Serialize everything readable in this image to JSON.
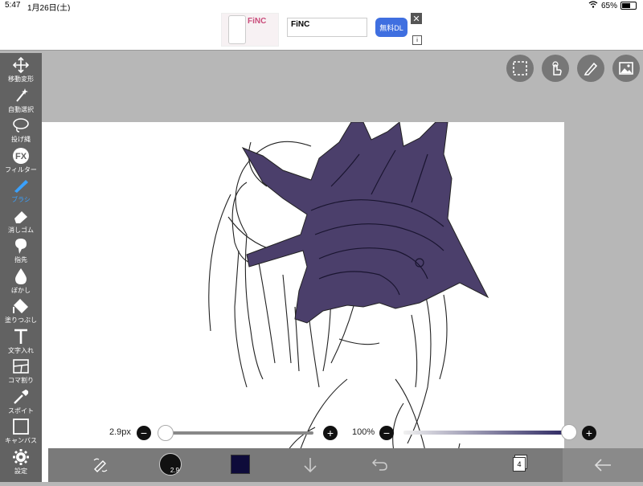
{
  "status": {
    "time": "5:47",
    "date": "1月26日(土)",
    "battery_percent": "65%",
    "battery_level": 0.65
  },
  "ad": {
    "brand": "FiNC",
    "title": "FiNC",
    "download_label": "無料DL",
    "close_icon": "close-icon",
    "info_icon": "info-icon"
  },
  "toolbar": {
    "tools": [
      {
        "label": "移動変形",
        "icon": "move-arrows-icon"
      },
      {
        "label": "自動選択",
        "icon": "magic-wand-icon"
      },
      {
        "label": "投げ縄",
        "icon": "lasso-icon"
      },
      {
        "label": "フィルター",
        "icon": "fx-icon"
      },
      {
        "label": "ブラシ",
        "icon": "brush-icon"
      },
      {
        "label": "消しゴム",
        "icon": "eraser-icon"
      },
      {
        "label": "指先",
        "icon": "finger-icon"
      },
      {
        "label": "ぼかし",
        "icon": "blur-drop-icon"
      },
      {
        "label": "塗りつぶし",
        "icon": "fill-bucket-icon"
      },
      {
        "label": "文字入れ",
        "icon": "text-icon"
      },
      {
        "label": "コマ割り",
        "icon": "panel-split-icon"
      },
      {
        "label": "スポイト",
        "icon": "eyedropper-icon"
      },
      {
        "label": "キャンバス",
        "icon": "canvas-icon"
      },
      {
        "label": "設定",
        "icon": "gear-icon"
      }
    ],
    "active_index": 4,
    "active_color": "#3aa1ff"
  },
  "top_buttons": [
    {
      "icon": "selection-rect-icon"
    },
    {
      "icon": "hand-touch-icon"
    },
    {
      "icon": "pencil-icon"
    },
    {
      "icon": "image-icon"
    }
  ],
  "sliders": {
    "brush_size_label": "2.9px",
    "brush_size_level": 0.02,
    "opacity_label": "100%",
    "opacity_level": 1.0,
    "minus_label": "−",
    "plus_label": "+"
  },
  "bottom_bar": {
    "brush_size_value": "2.9",
    "current_color": "#0e0b3a",
    "layer_count": "4",
    "icons": [
      "brush-swap-icon",
      "brush-size-icon",
      "color-swatch-icon",
      "arrow-down-icon",
      "undo-icon",
      "layers-icon",
      "back-arrow-icon"
    ]
  },
  "colors": {
    "toolbar_bg": "#626262",
    "helmet_fill": "#4b3f6b",
    "line": "#222222"
  }
}
